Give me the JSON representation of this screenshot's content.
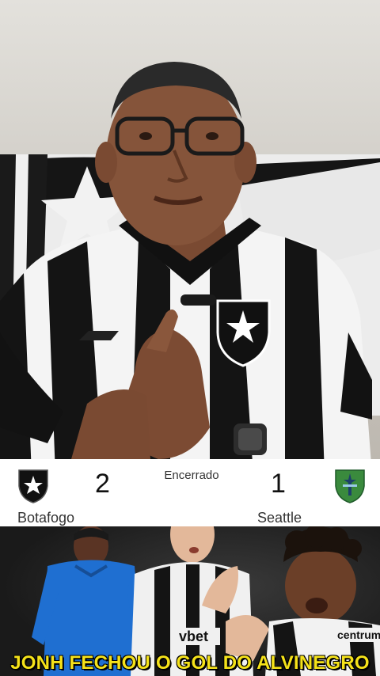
{
  "scoreboard": {
    "status": "Encerrado",
    "home": {
      "name": "Botafogo",
      "score": "2"
    },
    "away": {
      "name": "Seattle",
      "score": "1"
    }
  },
  "caption": "JONH FECHOU O GOL DO ALVINEGRO",
  "colors": {
    "caption_yellow": "#f5e21a",
    "botafogo_black": "#111111",
    "seattle_green": "#3a8a3d"
  },
  "icons": {
    "home_crest": "botafogo-star-crest-icon",
    "away_crest": "seattle-needle-crest-icon",
    "shirt_crest": "botafogo-star-crest-icon"
  }
}
